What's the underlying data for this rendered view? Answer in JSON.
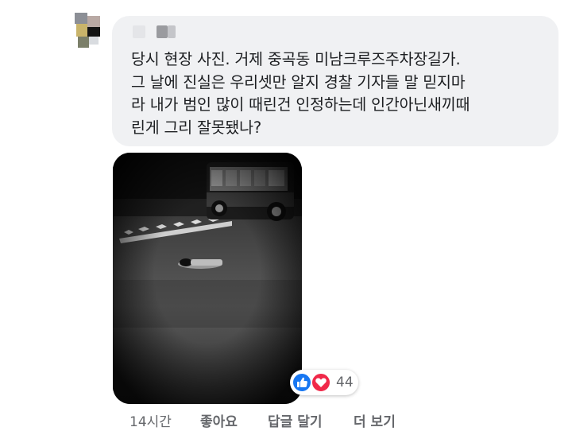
{
  "comment": {
    "author_name": "",
    "text": "당시 현장 사진. 거제 중곡동 미남크루즈주차장길가.\n그 날에 진실은 우리셋만 알지 경찰 기자들 말 믿지마\n라 내가 범인 많이 때린건 인정하는데 인간아닌새끼때\n린게 그리 잘못됐나?",
    "photo_label": "night-street-photo",
    "reactions": {
      "types": [
        "like-icon",
        "love-icon"
      ],
      "count": "44",
      "like_color": "#1877f2",
      "love_color": "#f02849"
    },
    "actions": {
      "time": "14시간",
      "like": "좋아요",
      "reply": "답글 달기",
      "more": "더 보기"
    }
  },
  "colors": {
    "bubble_bg": "#f0f1f3",
    "text": "#1c1e21",
    "meta_text": "#65676b"
  }
}
